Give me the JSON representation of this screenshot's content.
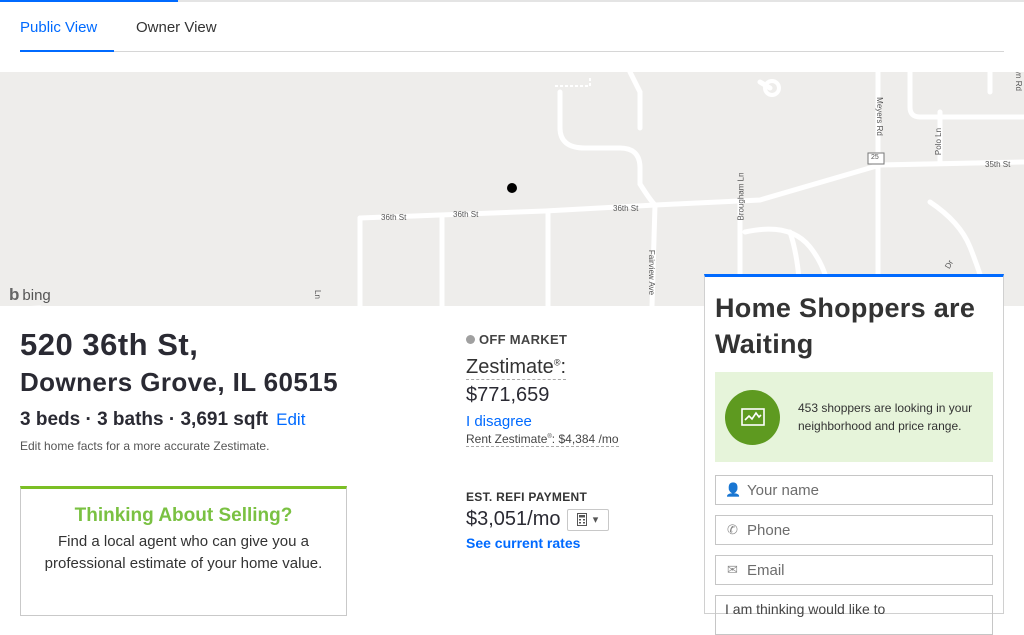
{
  "tabs": [
    {
      "label": "Public View",
      "active": true
    },
    {
      "label": "Owner View",
      "active": false
    }
  ],
  "map": {
    "brand": "bing",
    "streets": [
      "36th St",
      "36th St",
      "36th St",
      "35th St",
      "Meyers Rd",
      "Polo Ln",
      "Brougham Ln",
      "Fairview Ave",
      "25",
      "Ln",
      "Dr",
      "yn Rd"
    ]
  },
  "property": {
    "address_line1": "520 36th St,",
    "address_line2": "Downers Grove, IL 60515",
    "facts": "3 beds · 3 baths · 3,691 sqft",
    "edit_label": "Edit",
    "facts_note": "Edit home facts for a more accurate Zestimate."
  },
  "selling": {
    "title": "Thinking About Selling?",
    "text": "Find a local agent who can give you a professional estimate of your home value."
  },
  "zestimate": {
    "status": "OFF MARKET",
    "label": "Zestimate",
    "value": "$771,659",
    "disagree": "I disagree",
    "rent_label": "Rent Zestimate",
    "rent_value": ": $4,384 /mo"
  },
  "refi": {
    "label": "EST. REFI PAYMENT",
    "value": "$3,051/mo",
    "rates_link": "See current rates"
  },
  "shoppers": {
    "title": "Home Shoppers are Waiting",
    "banner": "453 shoppers are looking in your neighborhood and price range.",
    "name_placeholder": "Your name",
    "phone_placeholder": "Phone",
    "email_placeholder": "Email",
    "message": "I am thinking would like to"
  },
  "colors": {
    "accent": "#006aff",
    "selling_green": "#7ac142",
    "banner_green": "#e6f4da",
    "icon_green": "#5e9a20"
  }
}
